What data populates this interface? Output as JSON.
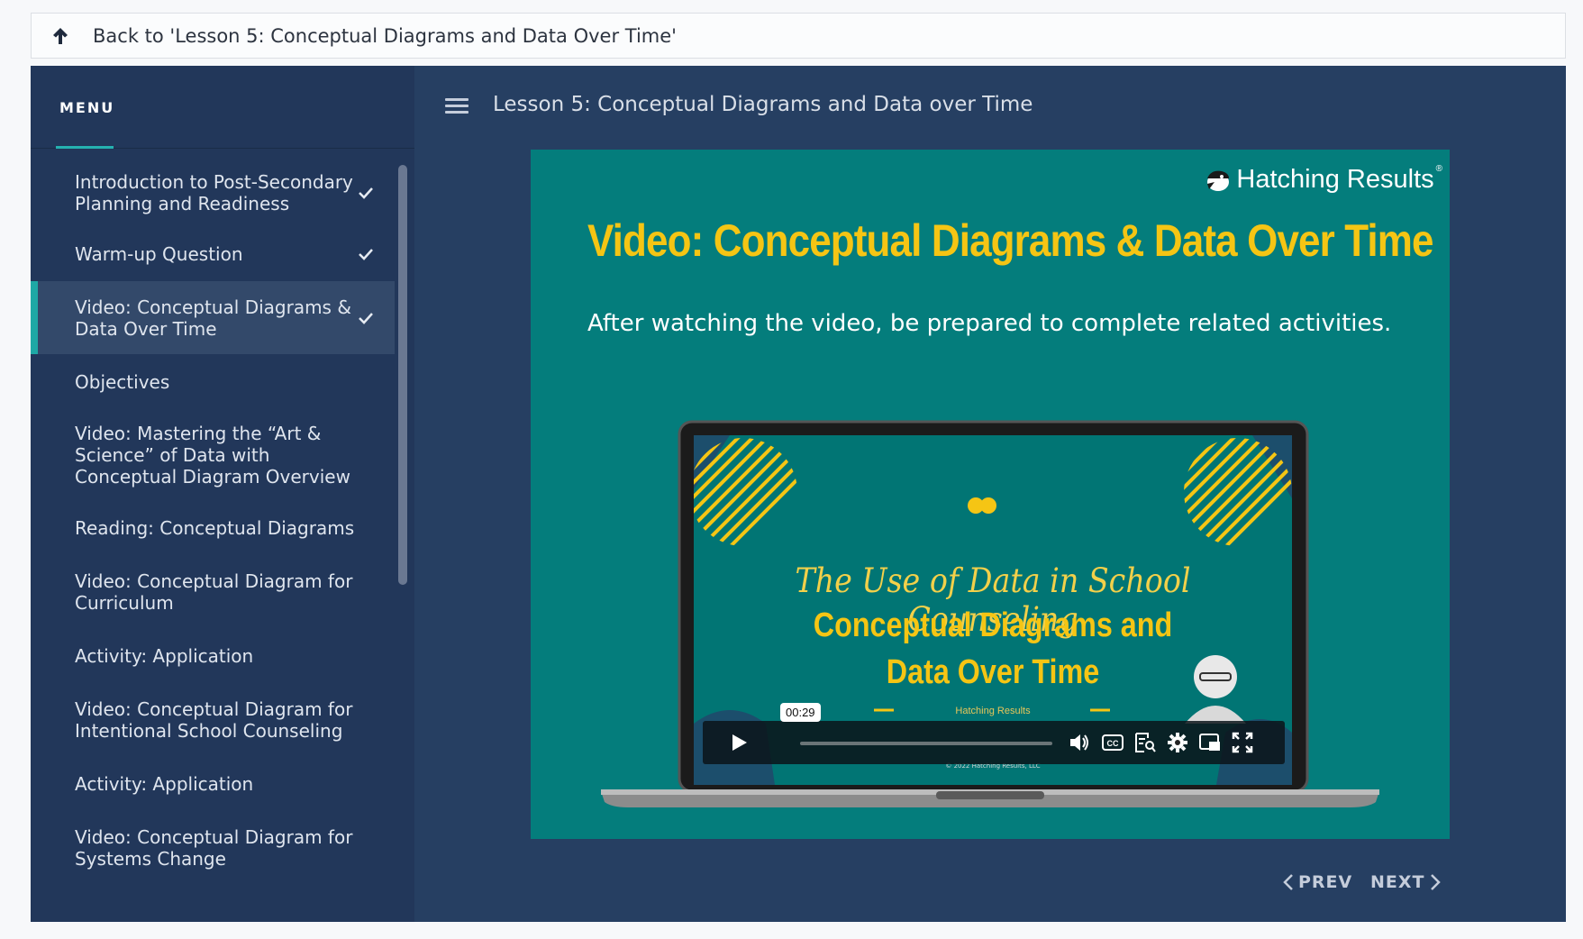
{
  "back": {
    "label": "Back to 'Lesson 5: Conceptual Diagrams and Data Over Time'"
  },
  "sidebar": {
    "menu_label": "MENU",
    "items": [
      {
        "label": "Introduction to Post-Secondary Planning and Readiness",
        "completed": true,
        "active": false
      },
      {
        "label": "Warm-up Question",
        "completed": true,
        "active": false
      },
      {
        "label": "Video: Conceptual Diagrams & Data Over Time",
        "completed": true,
        "active": true
      },
      {
        "label": "Objectives",
        "completed": false,
        "active": false
      },
      {
        "label": "Video: Mastering the “Art & Science” of Data with Conceptual Diagram Overview",
        "completed": false,
        "active": false
      },
      {
        "label": "Reading: Conceptual Diagrams",
        "completed": false,
        "active": false
      },
      {
        "label": "Video: Conceptual Diagram for Curriculum",
        "completed": false,
        "active": false
      },
      {
        "label": "Activity: Application",
        "completed": false,
        "active": false
      },
      {
        "label": "Video: Conceptual Diagram for Intentional School Counseling",
        "completed": false,
        "active": false
      },
      {
        "label": "Activity: Application",
        "completed": false,
        "active": false
      },
      {
        "label": "Video: Conceptual Diagram for Systems Change",
        "completed": false,
        "active": false
      }
    ]
  },
  "header": {
    "lesson_title": "Lesson 5: Conceptual Diagrams and Data over Time"
  },
  "slide": {
    "brand": "Hatching Results",
    "brand_mark": "®",
    "title": "Video: Conceptual Diagrams & Data Over Time",
    "subtitle": "After watching the video, be prepared to complete related activities.",
    "video": {
      "line1": "The Use of Data in School Counseling",
      "line2": "Conceptual Diagrams and",
      "line3": "Data Over Time",
      "brand": "Hatching Results",
      "copyright": "© 2022 Hatching Results, LLC",
      "timestamp": "00:29"
    }
  },
  "nav": {
    "prev": "PREV",
    "next": "NEXT"
  },
  "colors": {
    "accent": "#1ea8a5",
    "slide_bg": "#047d7c",
    "title_yellow": "#f5c514",
    "shell_bg": "#263f62",
    "sidebar_bg": "#22375a"
  }
}
